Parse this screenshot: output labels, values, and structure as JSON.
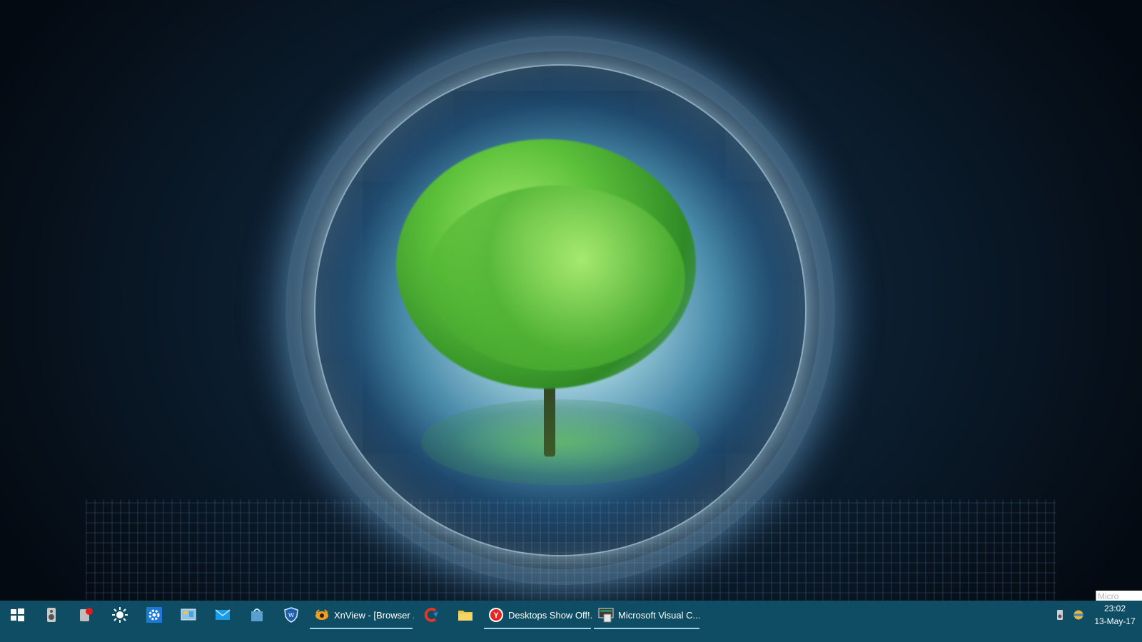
{
  "taskbar": {
    "pinned": [
      {
        "name": "start-button",
        "icon": "windows-logo-icon"
      },
      {
        "name": "speaker-app-button",
        "icon": "speaker-icon"
      },
      {
        "name": "record-app-button",
        "icon": "record-icon"
      },
      {
        "name": "brightness-app-button",
        "icon": "sun-icon"
      },
      {
        "name": "settings-app-button",
        "icon": "gear-icon"
      },
      {
        "name": "control-panel-button",
        "icon": "control-panel-icon"
      },
      {
        "name": "mail-app-button",
        "icon": "envelope-icon"
      },
      {
        "name": "store-app-button",
        "icon": "store-icon"
      },
      {
        "name": "shield-app-button",
        "icon": "shield-icon"
      }
    ],
    "tasks": {
      "xnview": {
        "label": "XnView - [Browser ...",
        "icon": "xnview-icon"
      },
      "desktops": {
        "label": "Desktops Show Off!...",
        "icon": "yandex-icon"
      },
      "vc": {
        "label": "Microsoft Visual C...",
        "icon": "visual-c-icon"
      }
    },
    "pinned_mid": [
      {
        "name": "ccleaner-button",
        "icon": "ccleaner-icon"
      },
      {
        "name": "file-explorer-button",
        "icon": "folder-icon"
      }
    ],
    "tray": {
      "time": "23:02",
      "date": "13-May-17"
    }
  },
  "tooltip": {
    "text": "Micro"
  },
  "colors": {
    "taskbar": "#0e4d63",
    "active_indicator": "#9fd6ea"
  }
}
